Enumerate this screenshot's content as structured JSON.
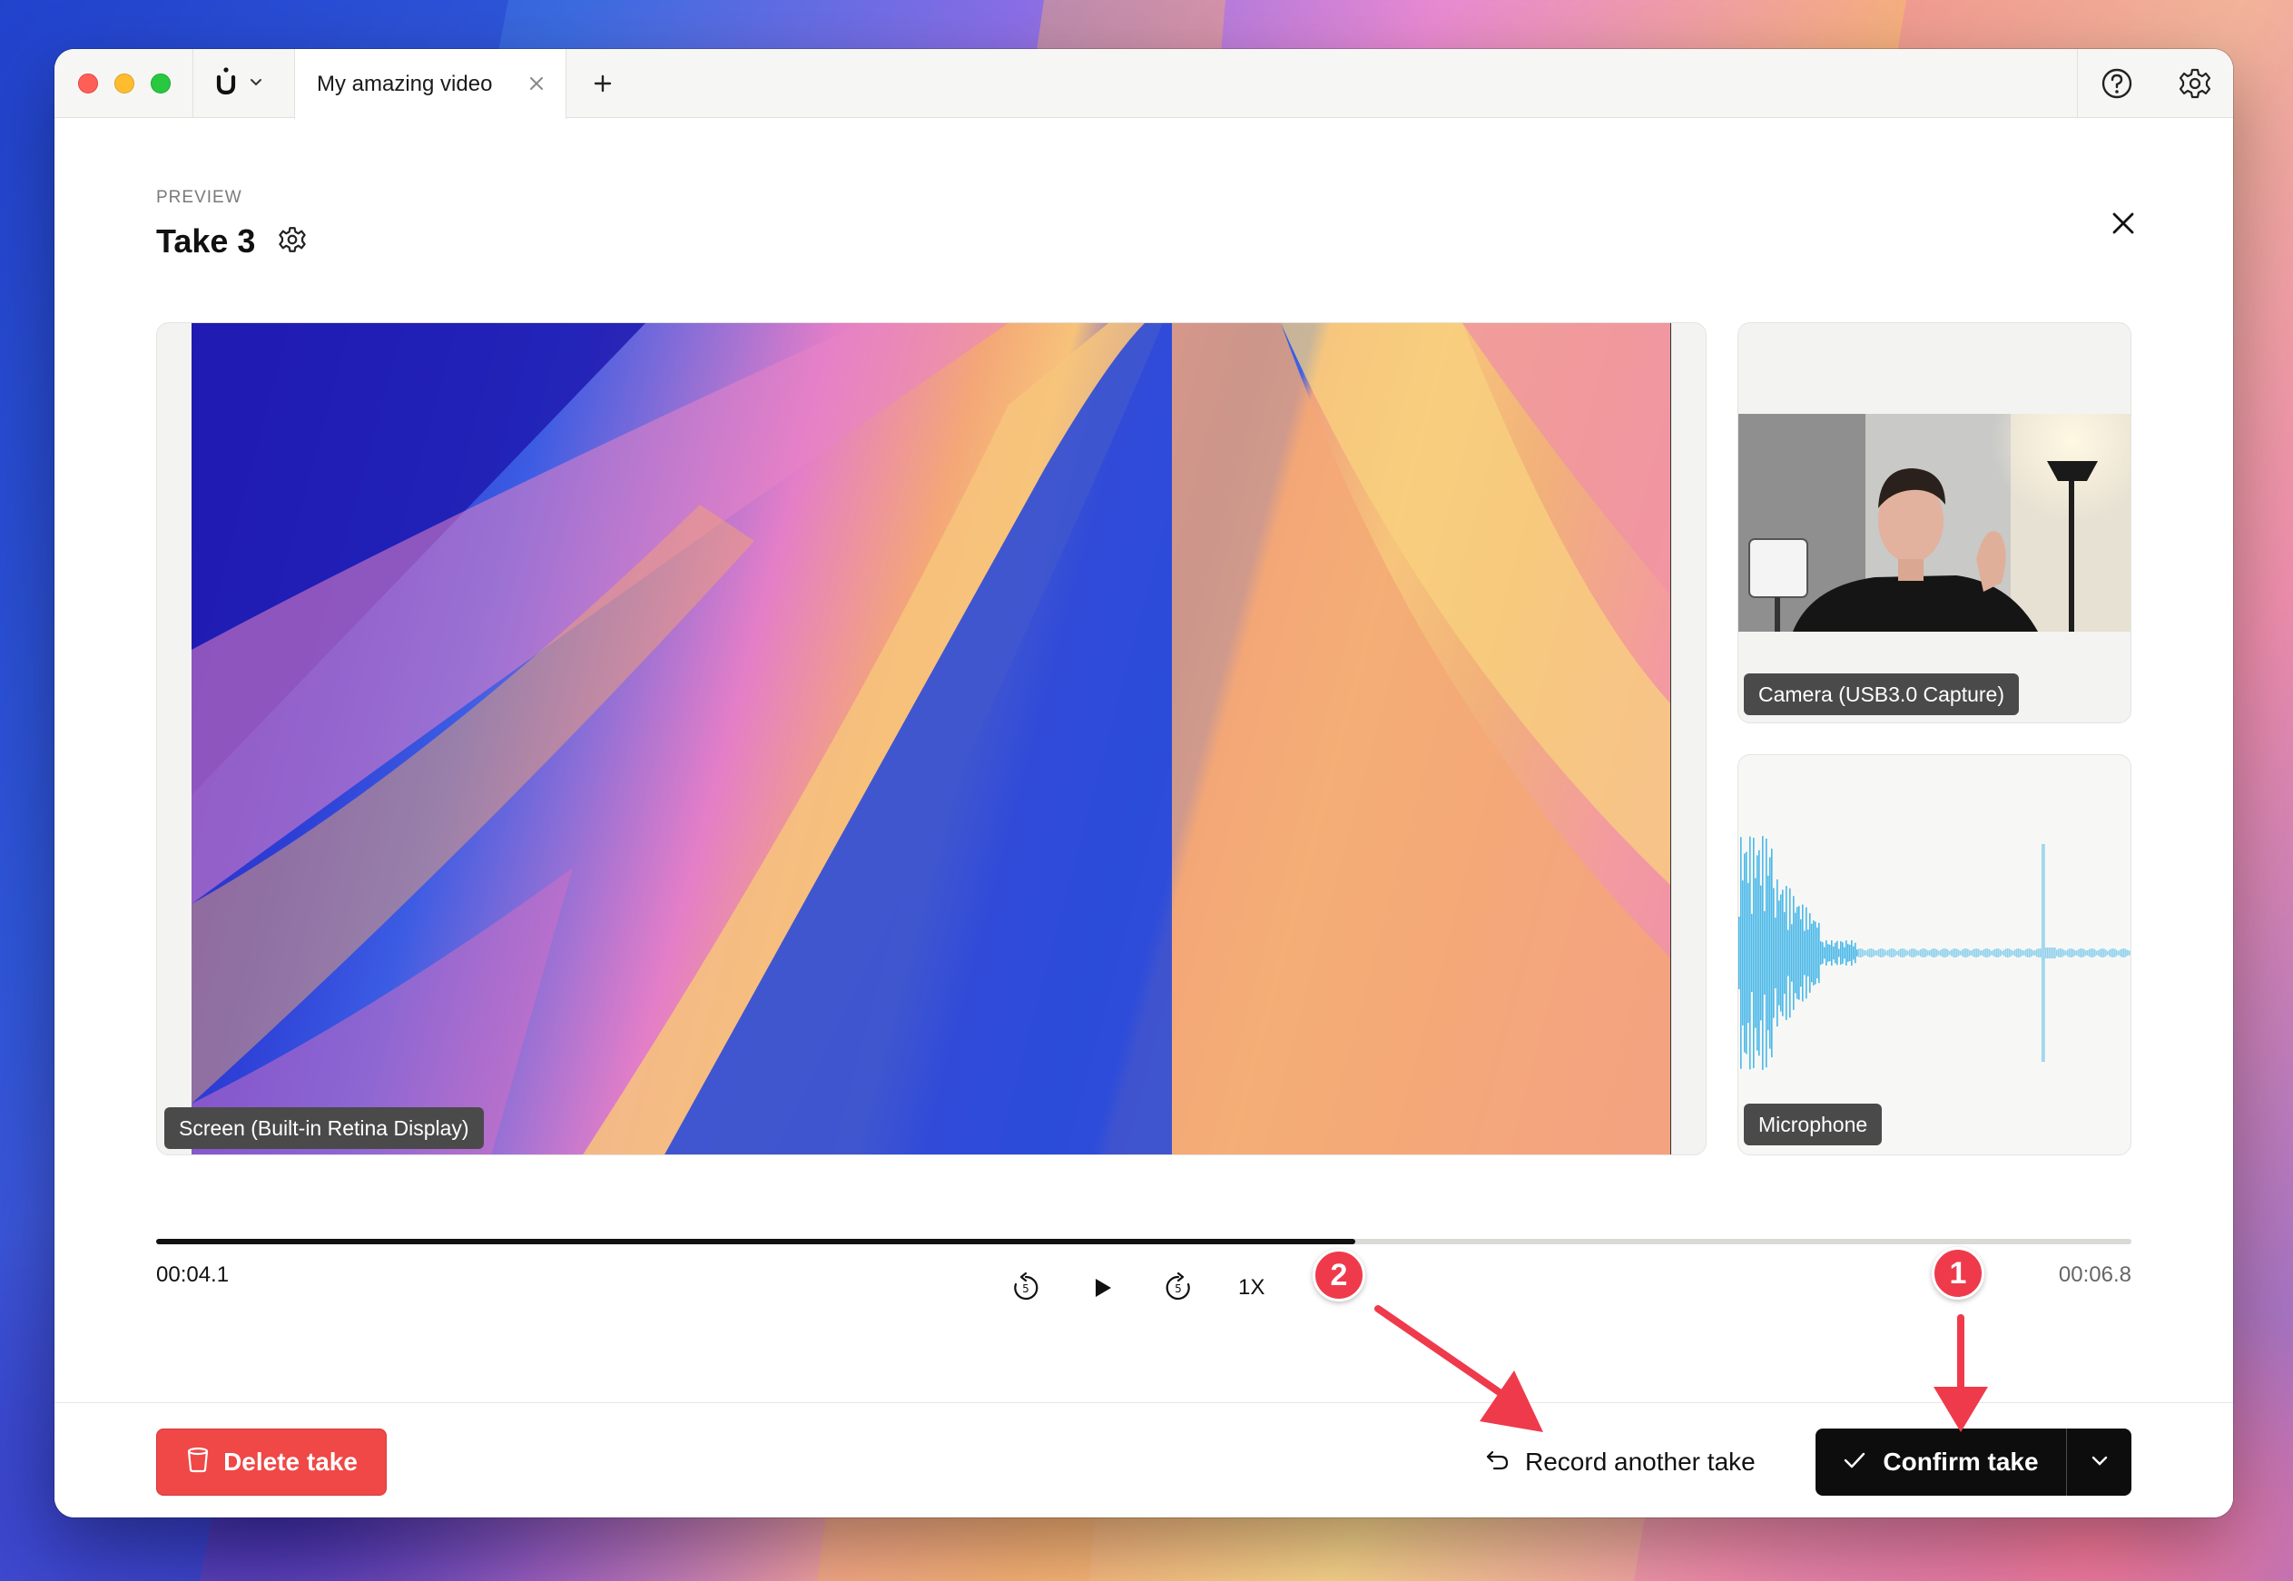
{
  "titlebar": {
    "tab_title": "My amazing video"
  },
  "preview": {
    "eyebrow": "PREVIEW",
    "title": "Take 3"
  },
  "sources": {
    "screen_label": "Screen (Built-in Retina Display)",
    "camera_label": "Camera (USB3.0 Capture)",
    "microphone_label": "Microphone"
  },
  "playback": {
    "current_time": "00:04.1",
    "total_time": "00:06.8",
    "progress": 0.607,
    "speed": "1X"
  },
  "actions": {
    "delete_label": "Delete take",
    "record_label": "Record another take",
    "confirm_label": "Confirm take"
  },
  "annotations": {
    "badge_1": "1",
    "badge_2": "2",
    "color": "#ef3a4c"
  },
  "colors": {
    "delete": "#f04747",
    "confirm": "#0d0d0d",
    "waveform": "#4ab8e8"
  },
  "icons": {
    "app_menu": "logo-icon",
    "help": "help-icon",
    "settings": "gear-icon",
    "close": "close-icon"
  }
}
